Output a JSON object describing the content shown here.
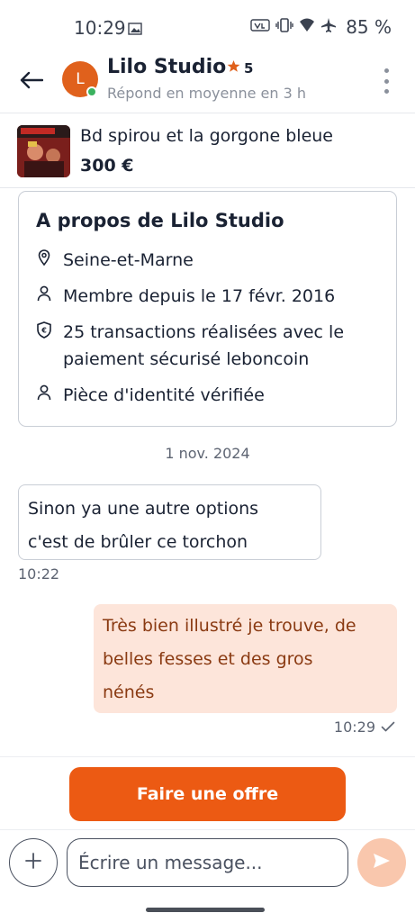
{
  "status_bar": {
    "time": "10:29",
    "battery": "85 %",
    "icons": [
      "image-icon",
      "volte-icon",
      "vibrate-icon",
      "wifi-icon",
      "airplane-icon"
    ]
  },
  "header": {
    "back_icon": "arrow-left-icon",
    "avatar_letter": "L",
    "seller_name": "Lilo Studio",
    "rating": "5",
    "response_time": "Répond en moyenne en 3 h",
    "more_icon": "more-vertical-icon"
  },
  "listing": {
    "title": "Bd spirou et la gorgone bleue",
    "price": "300 €"
  },
  "about": {
    "title": "A propos de Lilo Studio",
    "location": "Seine-et-Marne",
    "member_since": "Membre depuis le 17 févr. 2016",
    "transactions": "25 transactions réalisées avec le paiement sécurisé leboncoin",
    "identity": "Pièce d'identité vérifiée"
  },
  "conversation": {
    "date": "1 nov. 2024",
    "messages": [
      {
        "direction": "in",
        "lines": [
          "Sinon ya une autre options",
          "c'est de brûler ce torchon"
        ],
        "time": "10:22"
      },
      {
        "direction": "out",
        "lines": [
          "Très bien illustré je trouve, de",
          "belles fesses et des gros",
          "nénés"
        ],
        "time": "10:29",
        "status_icon": "check-icon"
      }
    ]
  },
  "actions": {
    "offer_label": "Faire une offre"
  },
  "composer": {
    "placeholder": "Écrire un message...",
    "attach_icon": "plus-icon",
    "send_icon": "send-icon"
  },
  "colors": {
    "brand": "#ec5a13",
    "outgoing_bubble": "#fde5da",
    "outgoing_text": "#8a3a12",
    "online": "#3bb25f"
  }
}
